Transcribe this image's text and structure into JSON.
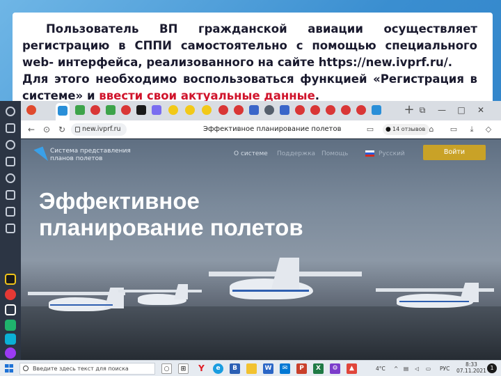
{
  "slide": {
    "paragraph1_lines": [
      "Пользователь ВП гражданской авиации осуществляет",
      "регистрацию в СППИ самостоятельно с помощью специального web-",
      "интерфейса, реализованного на сайте https://new.ivprf.ru/."
    ],
    "paragraph2_prefix": "Для этого необходимо воспользоваться функцией «Регистрация в",
    "paragraph2_mid": "системе» и ",
    "paragraph2_highlight": "ввести свои актуальные данные",
    "paragraph2_end": "."
  },
  "browser": {
    "url": "new.ivprf.ru",
    "page_title": "Эффективное планирование полетов",
    "reviews_label": "14 отзывов",
    "tab_add": "+",
    "window_controls": [
      "⧉",
      "—",
      "□",
      "✕"
    ]
  },
  "site": {
    "logo_text_line1": "Система представления",
    "logo_text_line2": "планов полетов",
    "nav": [
      "О системе",
      "Поддержка",
      "Помощь"
    ],
    "language": "Русский",
    "login_label": "Войти",
    "hero_title_line1": "Эффективное",
    "hero_title_line2": "планирование полетов"
  },
  "taskbar": {
    "search_placeholder": "Введите здесь текст для поиска",
    "temperature": "4°C",
    "language": "РУС",
    "time": "8:33",
    "date": "07.11.2021",
    "notifications": "1"
  },
  "colors": {
    "slide_background": "#3a8ed0",
    "highlight_red": "#d0142c",
    "login_button": "#c9a227",
    "logo_blue": "#3aa0e8"
  }
}
